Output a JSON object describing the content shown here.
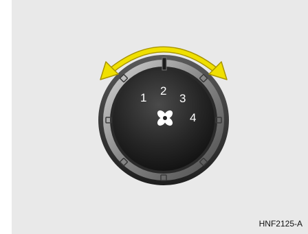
{
  "fan_control": {
    "speed_labels": [
      "1",
      "2",
      "3",
      "4"
    ],
    "center_icon": "fan-icon",
    "rotation_arrow_icon": "double-headed-curved-arrow-icon",
    "image_code": "HNF2125-A"
  },
  "colors": {
    "background": "#e9e9e9",
    "arrow": "#f0e000",
    "arrow_outline": "#a89400",
    "knob_face": "#1a1a1a",
    "knob_ring": "#8a8a8a"
  }
}
